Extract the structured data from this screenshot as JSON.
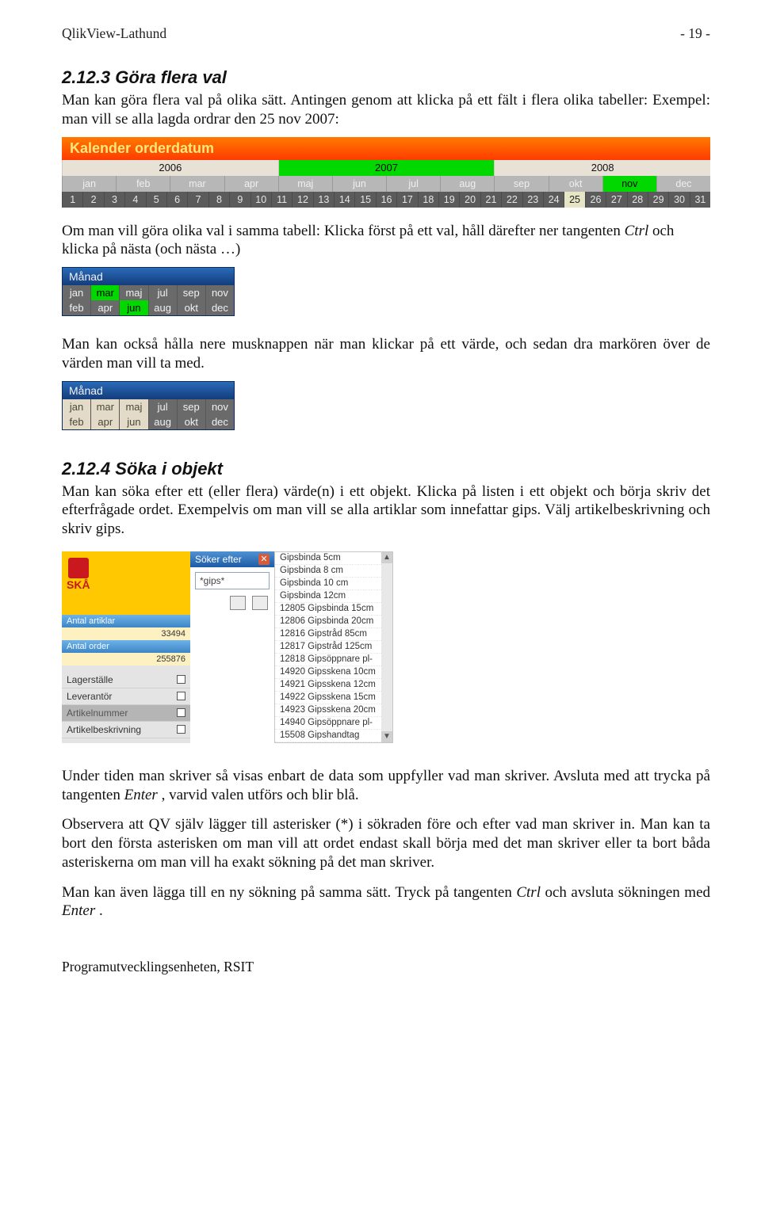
{
  "header": {
    "left": "QlikView-Lathund",
    "right": "- 19 -"
  },
  "sec1": {
    "title": "2.12.3 Göra flera val",
    "p1": "Man kan göra flera val på olika sätt. Antingen genom att klicka på ett fält i flera olika tabeller: Exempel: man vill se alla lagda ordrar den 25 nov 2007:",
    "p2_a": "Om man vill göra olika val i samma tabell: Klicka först på ett val, håll därefter ner tangenten ",
    "p2_ctrl": "Ctrl",
    "p2_b": " och klicka på nästa (och nästa …)",
    "p3": "Man kan också hålla nere musknappen när man klickar på ett värde, och sedan dra markören över de värden man vill ta med."
  },
  "cal": {
    "title": "Kalender orderdatum",
    "years": [
      "2006",
      "2007",
      "2008"
    ],
    "year_selected_index": 1,
    "months": [
      "jan",
      "feb",
      "mar",
      "apr",
      "maj",
      "jun",
      "jul",
      "aug",
      "sep",
      "okt",
      "nov",
      "dec"
    ],
    "month_selected_index": 10,
    "days": [
      "1",
      "2",
      "3",
      "4",
      "5",
      "6",
      "7",
      "8",
      "9",
      "10",
      "11",
      "12",
      "13",
      "14",
      "15",
      "16",
      "17",
      "18",
      "19",
      "20",
      "21",
      "22",
      "23",
      "24",
      "25",
      "26",
      "27",
      "28",
      "29",
      "30",
      "31"
    ],
    "day_selected_index": 24
  },
  "monthbox1": {
    "title": "Månad",
    "row1": [
      "jan",
      "mar",
      "maj",
      "jul",
      "sep",
      "nov"
    ],
    "row2": [
      "feb",
      "apr",
      "jun",
      "aug",
      "okt",
      "dec"
    ],
    "r1sel": [
      1
    ],
    "r2sel": [
      2
    ]
  },
  "monthbox2": {
    "title": "Månad",
    "row1": [
      "jan",
      "mar",
      "maj",
      "jul",
      "sep",
      "nov"
    ],
    "row2": [
      "feb",
      "apr",
      "jun",
      "aug",
      "okt",
      "dec"
    ],
    "r1pale": [
      0,
      1,
      2
    ],
    "r2pale": [
      0,
      1,
      2
    ]
  },
  "sec2": {
    "title": "2.12.4 Söka i objekt",
    "p1": "Man kan söka efter ett (eller flera) värde(n) i ett objekt. Klicka på listen i ett objekt och börja skriv det efterfrågade ordet. Exempelvis om man vill se alla artiklar som innefattar gips. Välj artikelbeskrivning och skriv gips."
  },
  "search": {
    "ska": "SKÅ",
    "stat1_lbl": "Antal artiklar",
    "stat1_val": "33494",
    "stat2_lbl": "Antal order",
    "stat2_val": "255876",
    "cat1": "Lagerställe",
    "cat2": "Leverantör",
    "cat3": "Artikelnummer",
    "cat4": "Artikelbeskrivning",
    "popup_title": "Söker efter",
    "input": "*gips*",
    "results": [
      "Gipsbinda 5cm",
      "Gipsbinda 8 cm",
      "Gipsbinda 10 cm",
      "Gipsbinda 12cm",
      "12805 Gipsbinda 15cm",
      "12806 Gipsbinda 20cm",
      "12816 Gipstråd 85cm",
      "12817 Gipstråd 125cm",
      "12818 Gipsöppnare pl-",
      "14920 Gipsskena 10cm",
      "14921 Gipsskena 12cm",
      "14922 Gipsskena 15cm",
      "14923 Gipsskena 20cm",
      "14940 Gipsöppnare pl-",
      "15508 Gipshandtag"
    ]
  },
  "tail": {
    "p1_a": "Under tiden man skriver så visas enbart de data som uppfyller vad man skriver. Avsluta med att trycka på tangenten ",
    "p1_enter": "Enter",
    "p1_b": ", varvid valen utförs och blir blå.",
    "p2": "Observera att QV själv lägger till asterisker (*) i sökraden före och efter vad man skriver in. Man kan ta bort den första asterisken om man vill att ordet endast skall börja med det man skriver eller ta bort båda asteriskerna om man vill ha exakt sökning på det man skriver.",
    "p3_a": "Man kan även lägga till en ny sökning på samma sätt. Tryck på tangenten ",
    "p3_ctrl": "Ctrl",
    "p3_b": " och avsluta sökningen med ",
    "p3_enter": "Enter",
    "p3_c": "."
  },
  "footer": "Programutvecklingsenheten, RSIT"
}
